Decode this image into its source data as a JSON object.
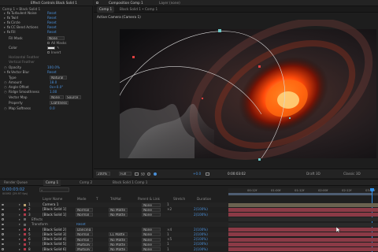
{
  "effect_controls": {
    "tab_label": "Effect Controls Black Solid 1",
    "layer_label": "Comp 1 • Black Solid 1",
    "rows": [
      {
        "label": "Turbulent Noise",
        "value": "Reset"
      },
      {
        "label": "Twirl",
        "value": "Reset"
      },
      {
        "label": "Circle",
        "value": "Reset"
      },
      {
        "label": "CC Bend Actions",
        "value": "Reset"
      },
      {
        "label": "Fill",
        "value": "Reset"
      }
    ],
    "fill_mask_label": "Fill Mask",
    "fill_mask_value": "None",
    "all_masks_label": "All Masks",
    "color_label": "Color",
    "invert_label": "Invert",
    "horizontal_feather_label": "Horizontal Feather",
    "vertical_feather_label": "Vertical Feather",
    "opacity_label": "Opacity",
    "opacity_value": "100.0%",
    "vector_blur_label": "Vector Blur",
    "vector_blur_value": "Reset",
    "type_label": "Type",
    "type_value": "Natural",
    "amount_label": "Amount",
    "amount_value": "18.0",
    "angle_offset_label": "Angle Offset",
    "angle_offset_value": "0x+0.0°",
    "ridge_smoothness_label": "Ridge Smoothness",
    "ridge_smoothness_value": "1.00",
    "vector_map_label": "Vector Map",
    "vector_map_value": "None",
    "vector_map_source": "Source",
    "property_label": "Property",
    "property_value": "Lightness",
    "map_softness_label": "Map Softness",
    "map_softness_value": "0.0"
  },
  "composition": {
    "tab_label": "Composition Comp 1",
    "sub_tab_1": "Comp 1",
    "sub_tab_2": "Black Solid 1 • Comp 1",
    "layer_tab": "Layer (none)",
    "view_label": "Active Camera (Camera 1)",
    "zoom": "200%",
    "resolution": "Full",
    "timecode": "0:00:03:02",
    "camera_select": "Active Camera",
    "views_select": "1 View",
    "draft": "Draft 3D",
    "classic": "Classic 3D",
    "exposure": "+0.0"
  },
  "timeline": {
    "tabs": [
      "Render Queue",
      "Comp 1",
      "Comp 2",
      "Black Solid 1 Comp 1"
    ],
    "timecode": "0:00:03:02",
    "fps": "00092 (29.97 fps)",
    "ruler": [
      "00:12f",
      "01:00f",
      "01:12f",
      "02:00f",
      "02:12f",
      "03:00f",
      "03:12f"
    ],
    "headers": {
      "layer_name": "Layer Name",
      "mode": "Mode",
      "t": "T",
      "trkmat": "TrkMat",
      "parent": "Parent & Link",
      "stretch": "Stretch",
      "duration": "Duration"
    },
    "rows": [
      {
        "num": "1",
        "name": "Camera 1",
        "mode": "",
        "trkmat": "",
        "parent": "None",
        "duration": "1",
        "stretch": ""
      },
      {
        "num": "2",
        "name": "[Black Solid 1]",
        "mode": "Normal",
        "trkmat": "No Matte",
        "parent": "None",
        "duration": "×2",
        "stretch": "2(100%)"
      },
      {
        "num": "3",
        "name": "[Black Solid 1]",
        "mode": "Normal",
        "trkmat": "No Matte",
        "parent": "None",
        "duration": "",
        "stretch": "2(100%)"
      },
      {
        "num": "",
        "name": "Effects",
        "mode": "",
        "trkmat": "",
        "parent": "",
        "duration": "",
        "stretch": ""
      },
      {
        "num": "",
        "name": "Transform",
        "mode": "Reset",
        "trkmat": "",
        "parent": "",
        "duration": "",
        "stretch": ""
      },
      {
        "num": "4",
        "name": "[Black Solid 2]",
        "mode": "Dancing",
        "trkmat": "",
        "parent": "None",
        "duration": "×4",
        "stretch": "2(100%)"
      },
      {
        "num": "5",
        "name": "[Black Solid 3]",
        "mode": "Normal",
        "trkmat": "L1 Matte",
        "parent": "None",
        "duration": "1",
        "stretch": "2(100%)"
      },
      {
        "num": "6",
        "name": "[Black Solid 4]",
        "mode": "Normal",
        "trkmat": "No Matte",
        "parent": "None",
        "duration": "×5",
        "stretch": "2(100%)"
      },
      {
        "num": "7",
        "name": "[Black Solid 5]",
        "mode": "Multiply",
        "trkmat": "No Matte",
        "parent": "None",
        "duration": "1",
        "stretch": "2(100%)"
      },
      {
        "num": "8",
        "name": "[Black Solid 6]",
        "mode": "Multiply",
        "trkmat": "No Matte",
        "parent": "None",
        "duration": "1",
        "stretch": "2(100%)"
      }
    ]
  },
  "colors": {
    "accent": "#4a8fd8",
    "track_red": "#8b3a46",
    "playhead": "#2e8ee8"
  }
}
